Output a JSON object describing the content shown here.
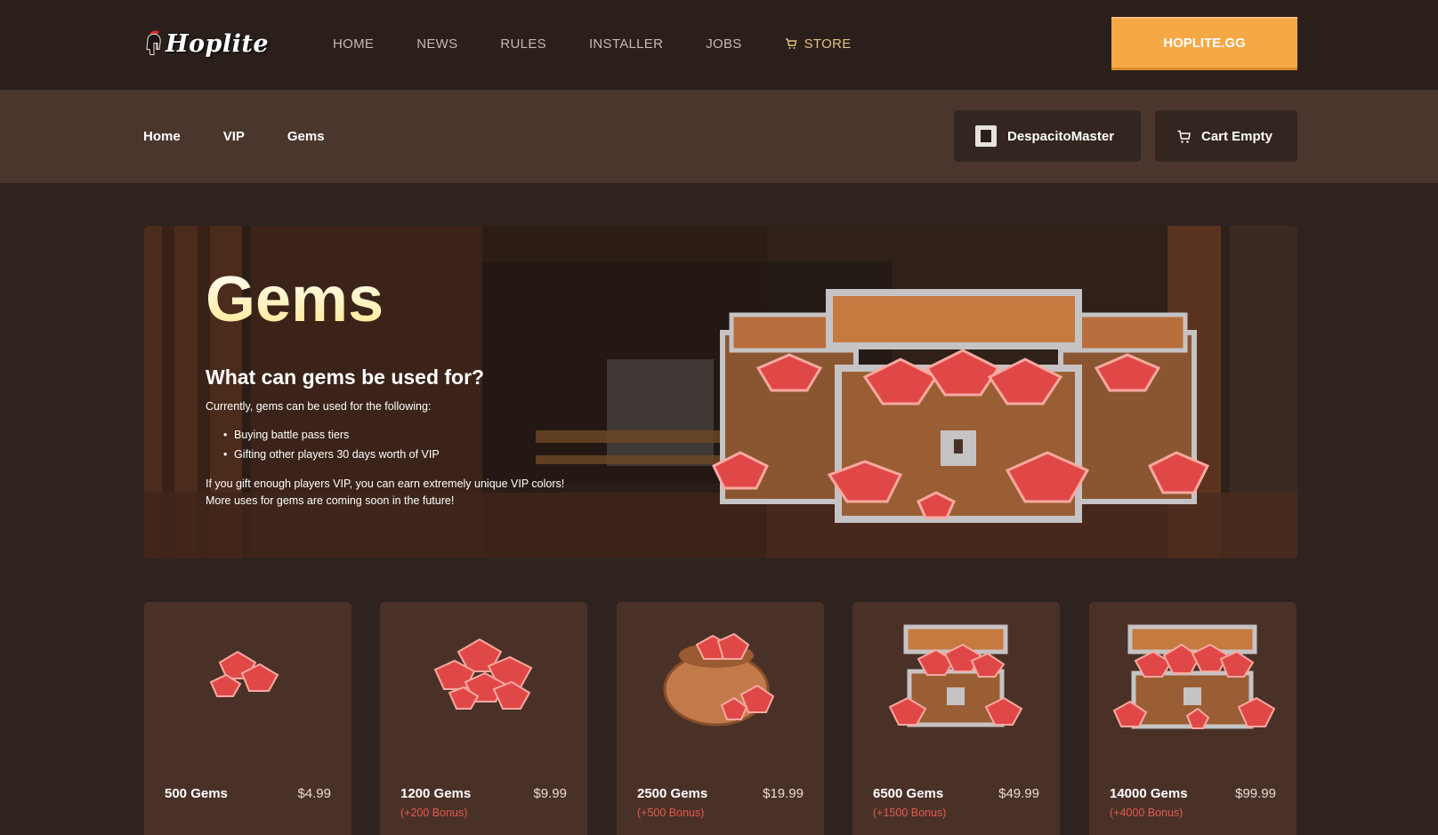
{
  "brand": {
    "name": "Hoplite"
  },
  "nav": {
    "items": [
      {
        "label": "HOME"
      },
      {
        "label": "NEWS"
      },
      {
        "label": "RULES"
      },
      {
        "label": "INSTALLER"
      },
      {
        "label": "JOBS"
      },
      {
        "label": "STORE",
        "icon": "cart-icon"
      }
    ],
    "cta_label": "HOPLITE.GG"
  },
  "breadcrumb": {
    "items": [
      "Home",
      "VIP",
      "Gems"
    ]
  },
  "account": {
    "username": "DespacitoMaster",
    "cart_label": "Cart Empty"
  },
  "hero": {
    "title": "Gems",
    "subtitle": "What can gems be used for?",
    "intro": "Currently, gems can be used for the following:",
    "uses": [
      "Buying battle pass tiers",
      "Gifting other players 30 days worth of VIP"
    ],
    "note_line1": "If you gift enough players VIP, you can earn extremely unique VIP colors!",
    "note_line2": "More uses for gems are coming soon in the future!"
  },
  "products": [
    {
      "name": "500 Gems",
      "price": "$4.99",
      "bonus": "",
      "image": "small-gem-pile"
    },
    {
      "name": "1200 Gems",
      "price": "$9.99",
      "bonus": "(+200 Bonus)",
      "image": "gem-pile"
    },
    {
      "name": "2500 Gems",
      "price": "$19.99",
      "bonus": "(+500 Bonus)",
      "image": "gem-bag"
    },
    {
      "name": "6500 Gems",
      "price": "$49.99",
      "bonus": "(+1500 Bonus)",
      "image": "gem-chest"
    },
    {
      "name": "14000 Gems",
      "price": "$99.99",
      "bonus": "(+4000 Bonus)",
      "image": "large-gem-chest"
    }
  ],
  "colors": {
    "topbar": "#2a1f1b",
    "subbar": "#4a362d",
    "accent": "#f6a845",
    "store_link": "#e2c27f",
    "bonus": "#e3584e",
    "card": "#4a3128",
    "gem": "#e04848"
  }
}
